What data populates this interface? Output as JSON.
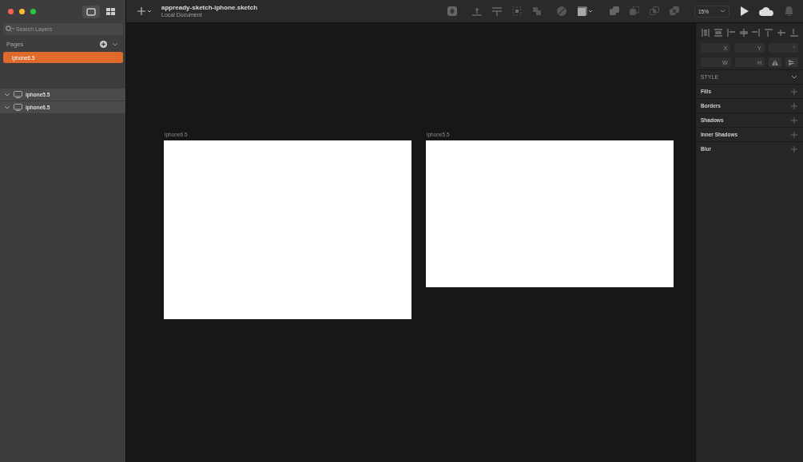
{
  "document": {
    "title": "appready-sketch-iphone.sketch",
    "subtitle": "Local Document"
  },
  "search": {
    "placeholder": "Search Layers"
  },
  "pages": {
    "heading": "Pages",
    "items": [
      {
        "label": "iphone6.5",
        "selected": true
      }
    ]
  },
  "layers": [
    {
      "label": "iphone5.5",
      "expanded": false
    },
    {
      "label": "iphone6.5",
      "expanded": false
    }
  ],
  "zoom": "15%",
  "artboards": [
    {
      "label": "iphone6.5"
    },
    {
      "label": "iphone5.5"
    }
  ],
  "inspector": {
    "fields": [
      {
        "label": "X"
      },
      {
        "label": "Y"
      },
      {
        "label": "°"
      },
      {
        "label": "W"
      },
      {
        "label": "H"
      }
    ],
    "style_heading": "STYLE",
    "sections": [
      "Fills",
      "Borders",
      "Shadows",
      "Inner Shadows",
      "Blur"
    ]
  }
}
